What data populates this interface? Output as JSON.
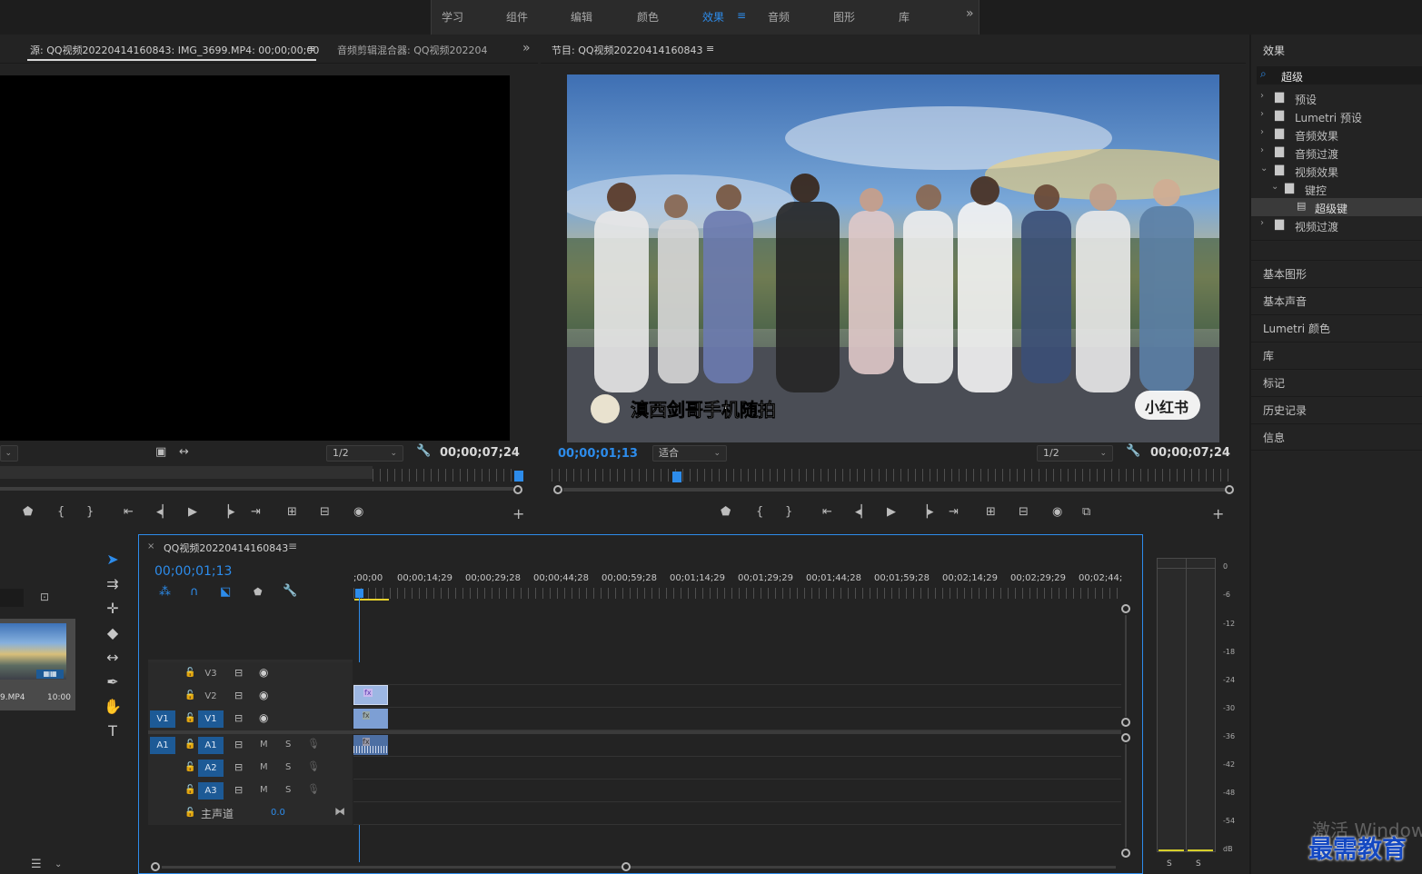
{
  "workspace": {
    "items": [
      "学习",
      "组件",
      "编辑",
      "颜色",
      "效果",
      "音频",
      "图形",
      "库"
    ],
    "active": "效果",
    "more": "»",
    "menu_glyph": "≡"
  },
  "source_panel": {
    "tab_source": "源: QQ视频20220414160843: IMG_3699.MP4: 00;00;00;00",
    "tab_mixer": "音频剪辑混合器: QQ视频202204",
    "zoom": "1/2",
    "duration": "00;00;07;24"
  },
  "program_panel": {
    "title": "节目: QQ视频20220414160843",
    "current_time": "00;00;01;13",
    "fit": "适合",
    "zoom": "1/2",
    "duration": "00;00;07;24",
    "caption": "滇西剑哥手机随拍",
    "badge": "小红书"
  },
  "effects_panel": {
    "title": "效果",
    "search_value": "超级",
    "tree": [
      {
        "label": "预设",
        "level": 0,
        "expanded": false,
        "icon": "preset-folder-icon"
      },
      {
        "label": "Lumetri 预设",
        "level": 0,
        "expanded": false,
        "icon": "preset-folder-icon"
      },
      {
        "label": "音频效果",
        "level": 0,
        "expanded": false,
        "icon": "folder-icon"
      },
      {
        "label": "音频过渡",
        "level": 0,
        "expanded": false,
        "icon": "folder-icon"
      },
      {
        "label": "视频效果",
        "level": 0,
        "expanded": true,
        "icon": "folder-icon"
      },
      {
        "label": "键控",
        "level": 1,
        "expanded": true,
        "icon": "folder-icon"
      },
      {
        "label": "超级键",
        "level": 2,
        "selected": true,
        "icon": "effect-icon"
      },
      {
        "label": "视频过渡",
        "level": 0,
        "expanded": false,
        "icon": "folder-icon"
      }
    ],
    "side_panels": [
      "基本图形",
      "基本声音",
      "Lumetri 颜色",
      "库",
      "标记",
      "历史记录",
      "信息"
    ]
  },
  "project_panel": {
    "clip_name": "9.MP4",
    "clip_duration": "10:00"
  },
  "timeline": {
    "sequence_name": "QQ视频20220414160843",
    "current_time": "00;00;01;13",
    "ruler_labels": [
      ";00;00",
      "00;00;14;29",
      "00;00;29;28",
      "00;00;44;28",
      "00;00;59;28",
      "00;01;14;29",
      "00;01;29;29",
      "00;01;44;28",
      "00;01;59;28",
      "00;02;14;29",
      "00;02;29;29",
      "00;02;44;"
    ],
    "video_tracks": [
      "V3",
      "V2",
      "V1"
    ],
    "audio_tracks": [
      "A1",
      "A2",
      "A3"
    ],
    "source_v": "V1",
    "source_a": "A1",
    "mute": "M",
    "solo": "S",
    "master_label": "主声道",
    "master_value": "0.0",
    "fx_label": "fx"
  },
  "audio_meter": {
    "scale": [
      "0",
      "-6",
      "-12",
      "-18",
      "-24",
      "-30",
      "-36",
      "-42",
      "-48",
      "-54",
      "dB"
    ],
    "solo_buttons": [
      "S",
      "S"
    ]
  },
  "watermark": {
    "text": "最需教育",
    "windows_text": "激活 Windows"
  },
  "colors": {
    "accent": "#2d8ceb",
    "panel_bg": "#232323",
    "track_button_on": "#1d5a96"
  }
}
